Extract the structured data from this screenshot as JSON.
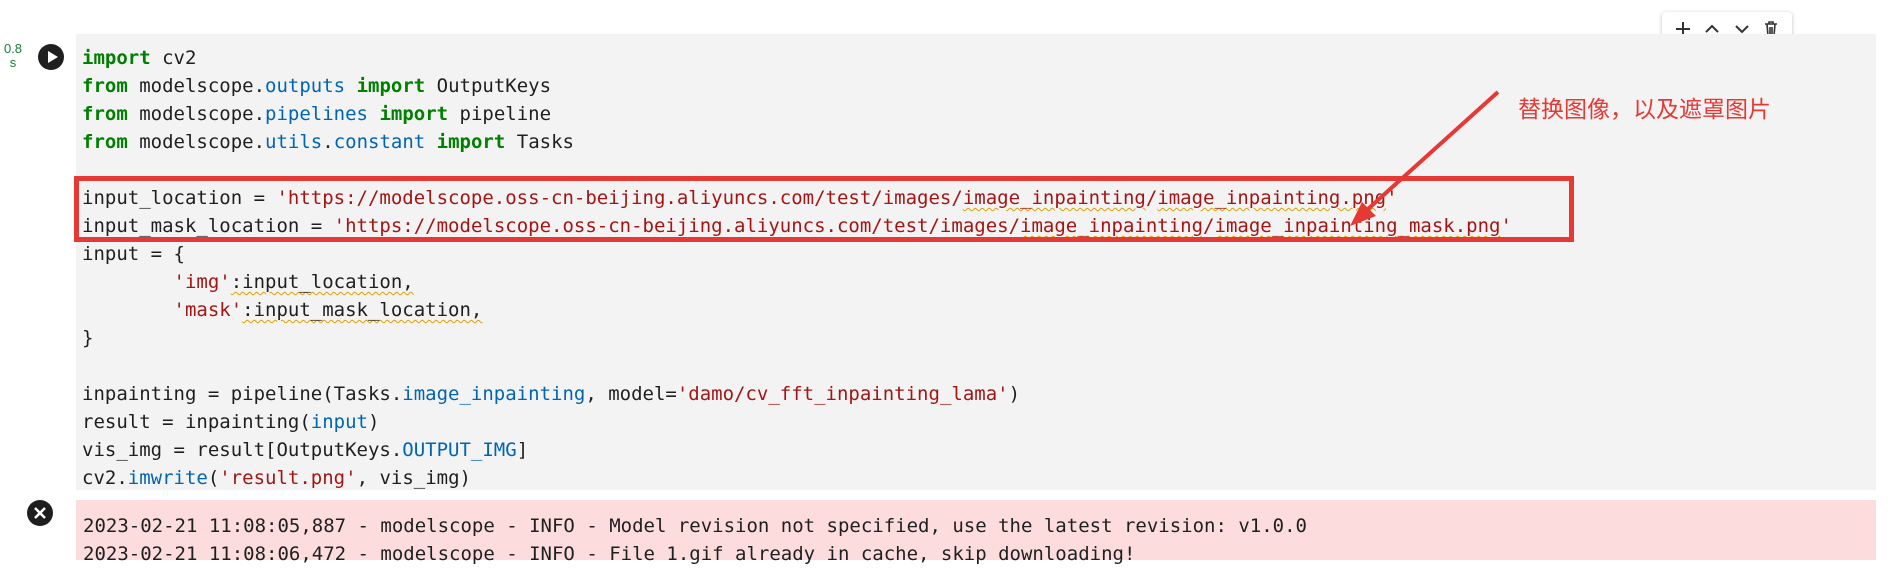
{
  "cell": {
    "exec_time_value": "0.8",
    "exec_time_unit": "s",
    "code_lines": [
      "import cv2",
      "from modelscope.outputs import OutputKeys",
      "from modelscope.pipelines import pipeline",
      "from modelscope.utils.constant import Tasks",
      "",
      "input_location = 'https://modelscope.oss-cn-beijing.aliyuncs.com/test/images/image_inpainting/image_inpainting.png'",
      "input_mask_location = 'https://modelscope.oss-cn-beijing.aliyuncs.com/test/images/image_inpainting/image_inpainting_mask.png'",
      "input = {",
      "        'img':input_location,",
      "        'mask':input_mask_location,",
      "}",
      "",
      "inpainting = pipeline(Tasks.image_inpainting, model='damo/cv_fft_inpainting_lama')",
      "result = inpainting(input)",
      "vis_img = result[OutputKeys.OUTPUT_IMG]",
      "cv2.imwrite('result.png', vis_img)"
    ]
  },
  "toolbar": {
    "icons": [
      "add-icon",
      "move-up-icon",
      "move-down-icon",
      "delete-icon"
    ]
  },
  "annotation": {
    "text": "替换图像，以及遮罩图片",
    "color": "#e53935"
  },
  "output": {
    "lines": [
      "2023-02-21 11:08:05,887 - modelscope - INFO - Model revision not specified, use the latest revision: v1.0.0",
      "2023-02-21 11:08:06,472 - modelscope - INFO - File 1.gif already in cache, skip downloading!"
    ],
    "background": "#fcdcdc"
  }
}
